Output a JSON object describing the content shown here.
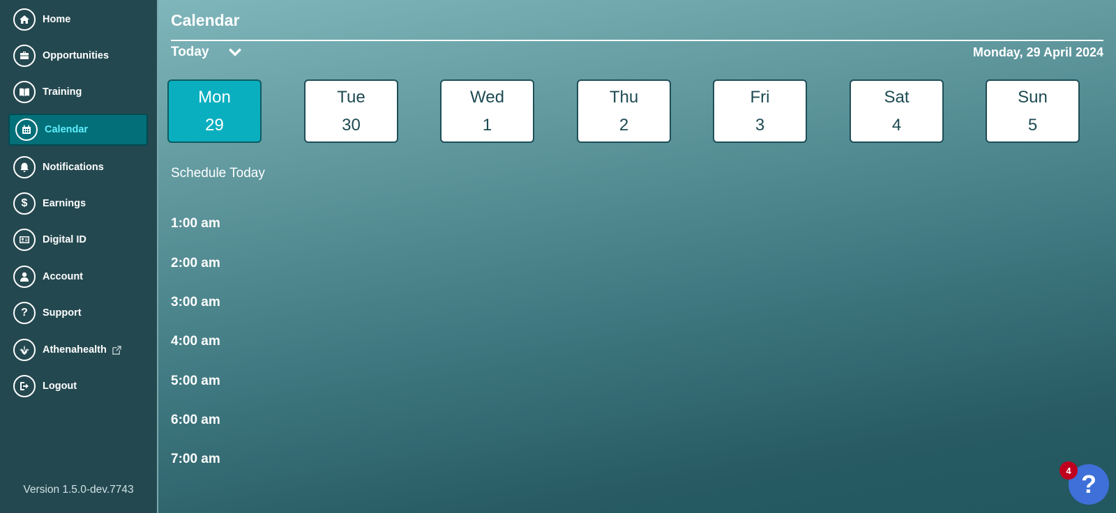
{
  "sidebar": {
    "items": [
      {
        "label": "Home",
        "icon": "home-icon",
        "active": false
      },
      {
        "label": "Opportunities",
        "icon": "briefcase-icon",
        "active": false
      },
      {
        "label": "Training",
        "icon": "book-icon",
        "active": false
      },
      {
        "label": "Calendar",
        "icon": "calendar-icon",
        "active": true
      },
      {
        "label": "Notifications",
        "icon": "bell-icon",
        "active": false
      },
      {
        "label": "Earnings",
        "icon": "dollar-icon",
        "active": false
      },
      {
        "label": "Digital ID",
        "icon": "id-card-icon",
        "active": false
      },
      {
        "label": "Account",
        "icon": "user-icon",
        "active": false
      },
      {
        "label": "Support",
        "icon": "question-icon",
        "active": false
      },
      {
        "label": "Athenahealth",
        "icon": "leaf-icon",
        "active": false,
        "external": true
      },
      {
        "label": "Logout",
        "icon": "logout-icon",
        "active": false
      }
    ],
    "version": "Version 1.5.0-dev.7743"
  },
  "main": {
    "title": "Calendar",
    "range_selector": "Today",
    "current_date": "Monday, 29 April 2024",
    "days": [
      {
        "name": "Mon",
        "date": "29",
        "selected": true
      },
      {
        "name": "Tue",
        "date": "30",
        "selected": false
      },
      {
        "name": "Wed",
        "date": "1",
        "selected": false
      },
      {
        "name": "Thu",
        "date": "2",
        "selected": false
      },
      {
        "name": "Fri",
        "date": "3",
        "selected": false
      },
      {
        "name": "Sat",
        "date": "4",
        "selected": false
      },
      {
        "name": "Sun",
        "date": "5",
        "selected": false
      }
    ],
    "schedule_title": "Schedule Today",
    "hours": [
      "1:00 am",
      "2:00 am",
      "3:00 am",
      "4:00 am",
      "5:00 am",
      "6:00 am",
      "7:00 am"
    ]
  },
  "help": {
    "badge_count": "4",
    "symbol": "?"
  },
  "colors": {
    "sidebar_bg": "#244850",
    "active_item_bg": "#036f78",
    "active_item_text": "#5ff0ff",
    "selected_day_bg": "#0aafbf",
    "help_button": "#3f6fd8",
    "badge": "#c0001e"
  }
}
